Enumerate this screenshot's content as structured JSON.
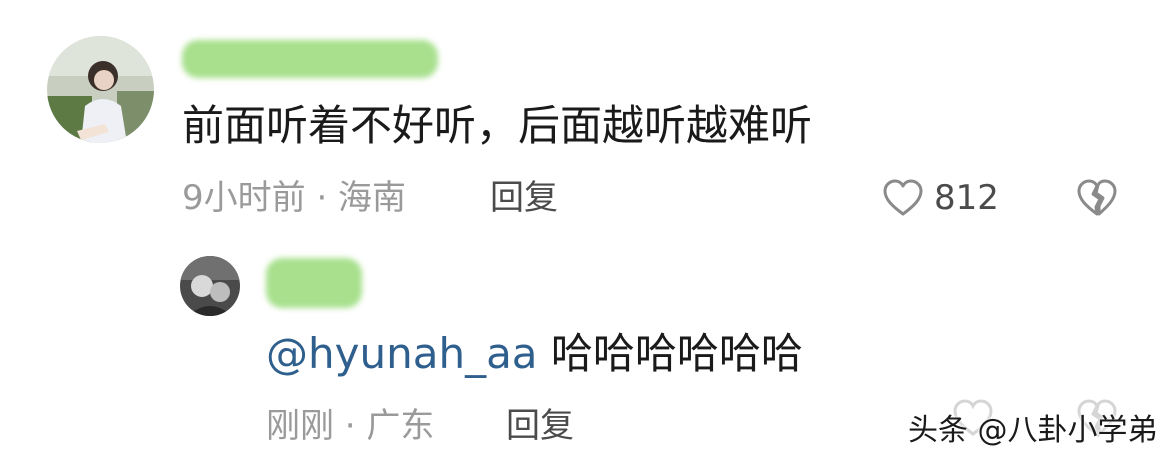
{
  "comment": {
    "text": "前面听着不好听，后面越听越难听",
    "meta_time": "9小时前 · 海南",
    "reply_label": "回复",
    "like_count": "812",
    "icons": [
      "heart-outline-icon",
      "broken-heart-icon"
    ]
  },
  "reply": {
    "mention": "@hyunah_aa",
    "text": "哈哈哈哈哈哈",
    "meta_time": "刚刚 · 广东",
    "reply_label": "回复"
  },
  "watermark": "头条 @八卦小学弟",
  "colors": {
    "text": "#1a1a1a",
    "meta": "#9a9a9a",
    "mention": "#2f5f8d",
    "name_mask": "#a8e08d"
  }
}
